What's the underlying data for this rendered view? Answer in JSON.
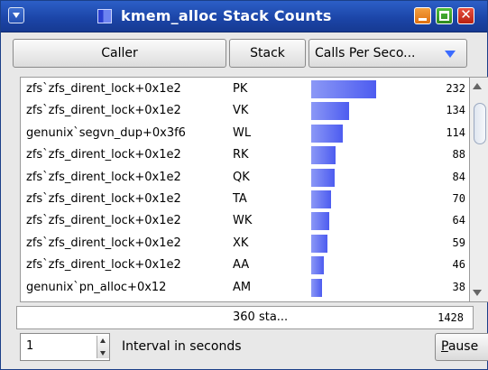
{
  "window": {
    "title": "kmem_alloc Stack Counts"
  },
  "columns": {
    "caller": "Caller",
    "stack": "Stack",
    "calls": "Calls Per Seco..."
  },
  "rows": [
    {
      "caller": "zfs`zfs_dirent_lock+0x1e2",
      "stack": "PK",
      "count": 232
    },
    {
      "caller": "zfs`zfs_dirent_lock+0x1e2",
      "stack": "VK",
      "count": 134
    },
    {
      "caller": "genunix`segvn_dup+0x3f6",
      "stack": "WL",
      "count": 114
    },
    {
      "caller": "zfs`zfs_dirent_lock+0x1e2",
      "stack": "RK",
      "count": 88
    },
    {
      "caller": "zfs`zfs_dirent_lock+0x1e2",
      "stack": "QK",
      "count": 84
    },
    {
      "caller": "zfs`zfs_dirent_lock+0x1e2",
      "stack": "TA",
      "count": 70
    },
    {
      "caller": "zfs`zfs_dirent_lock+0x1e2",
      "stack": "WK",
      "count": 64
    },
    {
      "caller": "zfs`zfs_dirent_lock+0x1e2",
      "stack": "XK",
      "count": 59
    },
    {
      "caller": "zfs`zfs_dirent_lock+0x1e2",
      "stack": "AA",
      "count": 46
    },
    {
      "caller": "genunix`pn_alloc+0x12",
      "stack": "AM",
      "count": 38
    }
  ],
  "footer": {
    "total_stacks": "360 sta...",
    "total_count": "1428"
  },
  "controls": {
    "interval_value": "1",
    "interval_label": "Interval in seconds",
    "pause_first": "P",
    "pause_rest": "ause"
  },
  "icons": {
    "window_menu": "chevron-down-icon",
    "app": "app-icon",
    "minimize": "minimize-icon",
    "maximize": "maximize-icon",
    "close": "close-icon",
    "sort": "sort-descending-icon"
  },
  "colors": {
    "titlebar": "#1b44a6",
    "bar": "#6473f3",
    "sort_arrow": "#3b6bff"
  }
}
